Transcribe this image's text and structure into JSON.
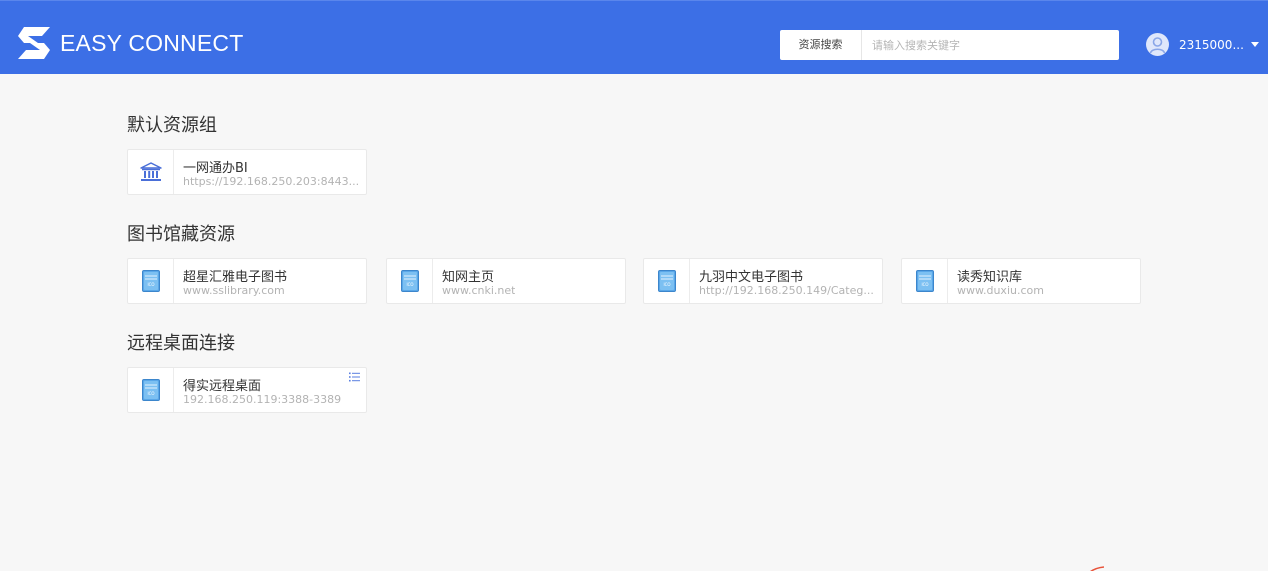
{
  "header": {
    "logo_text": "EASY CONNECT",
    "search_label": "资源搜索",
    "search_placeholder": "请输入搜索关键字",
    "search_value": "",
    "user_name": "2315000...",
    "bg_color": "#3c6fe6"
  },
  "groups": [
    {
      "title": "默认资源组",
      "items": [
        {
          "name": "一网通办BI",
          "url": "https://192.168.250.203:8443...",
          "icon": "bank-icon"
        }
      ]
    },
    {
      "title": "图书馆藏资源",
      "items": [
        {
          "name": "超星汇雅电子图书",
          "url": "www.sslibrary.com",
          "icon": "ico-book-icon"
        },
        {
          "name": "知网主页",
          "url": "www.cnki.net",
          "icon": "ico-book-icon"
        },
        {
          "name": "九羽中文电子图书",
          "url": "http://192.168.250.149/Categ...",
          "icon": "ico-book-icon"
        },
        {
          "name": "读秀知识库",
          "url": "www.duxiu.com",
          "icon": "ico-book-icon"
        }
      ]
    },
    {
      "title": "远程桌面连接",
      "items": [
        {
          "name": "得实远程桌面",
          "url": "192.168.250.119:3388-3389",
          "icon": "ico-book-icon"
        }
      ]
    }
  ]
}
